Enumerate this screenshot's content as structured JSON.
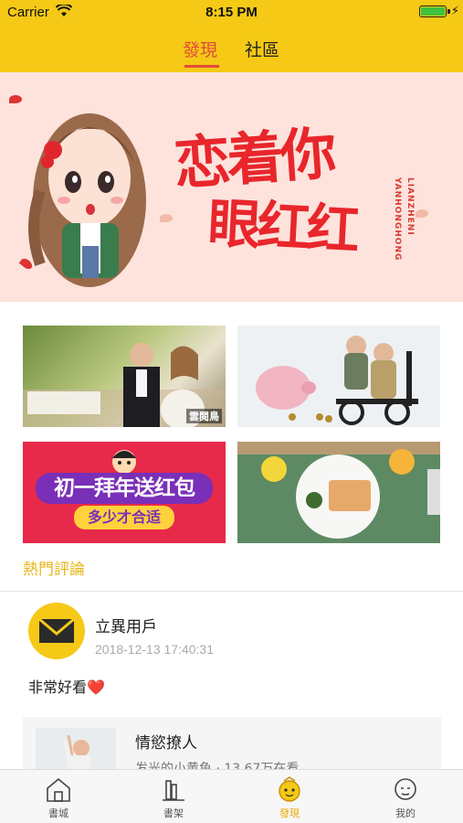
{
  "status_bar": {
    "carrier": "Carrier",
    "time": "8:15 PM"
  },
  "top_tabs": [
    {
      "label": "發現",
      "active": true
    },
    {
      "label": "社區",
      "active": false
    }
  ],
  "banner": {
    "line1": "恋着你",
    "line2": "眼红红",
    "side_text_1": "YANHONGHONG",
    "side_text_2": "LIANZHENI"
  },
  "tiles": {
    "promo_main": "初一拜年送红包",
    "promo_sub": "多少才合适",
    "watermark": "雲閱鳥"
  },
  "hot_comments": {
    "title": "熱門評論",
    "items": [
      {
        "username": "立異用戶",
        "time": "2018-12-13 17:40:31",
        "text": "非常好看❤️",
        "book": {
          "title": "情慾撩人",
          "meta": "发光的小黄鱼 · 13.67万在看"
        }
      }
    ]
  },
  "tabbar": [
    {
      "label": "書城",
      "icon": "house-icon",
      "active": false
    },
    {
      "label": "書架",
      "icon": "bookshelf-icon",
      "active": false
    },
    {
      "label": "發現",
      "icon": "discover-face-icon",
      "active": true
    },
    {
      "label": "我的",
      "icon": "profile-face-icon",
      "active": false
    }
  ],
  "colors": {
    "header": "#f5c915",
    "accent_red": "#e24b3b",
    "accent_yellow": "#e5b71a"
  }
}
